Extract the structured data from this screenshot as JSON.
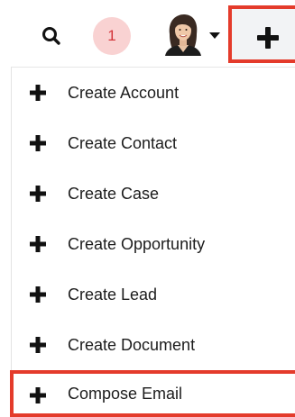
{
  "header": {
    "search": {
      "icon": "search-icon"
    },
    "notifications": {
      "count": "1",
      "color": "#d3353a",
      "bg": "#f9d2d2"
    },
    "user": {
      "icon": "avatar"
    },
    "quick_create": {
      "icon": "plus-icon",
      "highlight_color": "#e43b2b"
    }
  },
  "menu": {
    "items": [
      {
        "label": "Create Account",
        "icon": "plus-icon"
      },
      {
        "label": "Create Contact",
        "icon": "plus-icon"
      },
      {
        "label": "Create Case",
        "icon": "plus-icon"
      },
      {
        "label": "Create Opportunity",
        "icon": "plus-icon"
      },
      {
        "label": "Create Lead",
        "icon": "plus-icon"
      },
      {
        "label": "Create Document",
        "icon": "plus-icon"
      },
      {
        "label": "Compose Email",
        "icon": "plus-icon"
      }
    ]
  }
}
